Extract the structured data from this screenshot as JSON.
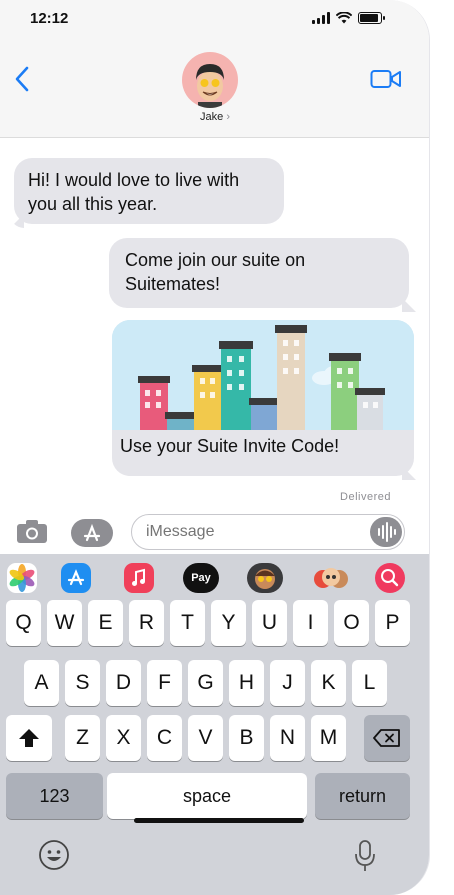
{
  "status_bar": {
    "time": "12:12"
  },
  "header": {
    "contact_name": "Jake",
    "contact_chevron": "›"
  },
  "messages": [
    {
      "direction": "incoming",
      "text": "Hi! I would love to live with you all this year."
    },
    {
      "direction": "outgoing",
      "text": "Come join our suite on Suitemates!"
    },
    {
      "direction": "outgoing",
      "type": "rich-link",
      "caption": "Use your Suite Invite Code!"
    }
  ],
  "delivery_status": "Delivered",
  "composer": {
    "placeholder": "iMessage"
  },
  "app_strip": {
    "items": [
      "photos-icon",
      "app-store-icon",
      "music-icon",
      "apple-pay-icon",
      "memoji-icon",
      "memoji-stickers-icon",
      "search-images-icon"
    ],
    "apple_pay_label": "Pay"
  },
  "keyboard": {
    "row1": [
      "Q",
      "W",
      "E",
      "R",
      "T",
      "Y",
      "U",
      "I",
      "O",
      "P"
    ],
    "row2": [
      "A",
      "S",
      "D",
      "F",
      "G",
      "H",
      "J",
      "K",
      "L"
    ],
    "row3": [
      "Z",
      "X",
      "C",
      "V",
      "B",
      "N",
      "M"
    ],
    "numbers_key": "123",
    "space_key": "space",
    "return_key": "return"
  },
  "colors": {
    "accent": "#1b7cf5",
    "bubble_gray": "#e5e5ea",
    "keyboard_bg": "#d1d3d9"
  }
}
